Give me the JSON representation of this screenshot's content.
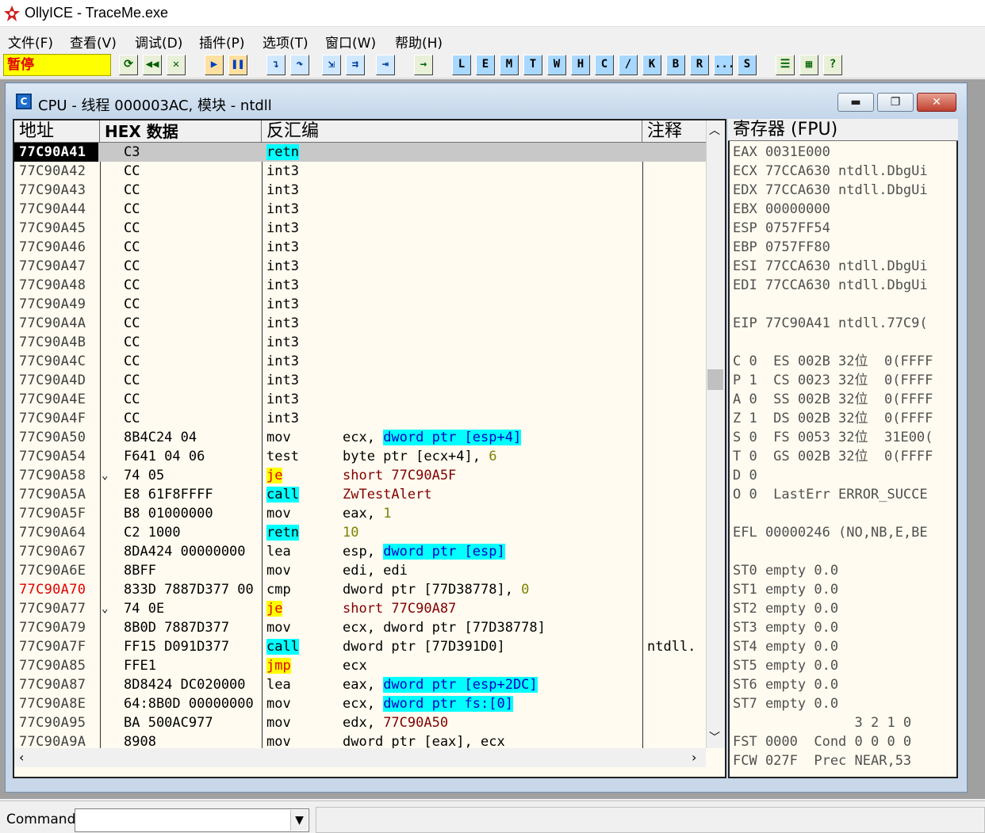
{
  "app": {
    "title": "OllyICE - TraceMe.exe"
  },
  "menu": [
    "文件(F)",
    "查看(V)",
    "调试(D)",
    "插件(P)",
    "选项(T)",
    "窗口(W)",
    "帮助(H)"
  ],
  "toolbar": {
    "status": "暂停",
    "letters": [
      "L",
      "E",
      "M",
      "T",
      "W",
      "H",
      "C",
      "/",
      "K",
      "B",
      "R",
      "...",
      "S"
    ]
  },
  "cpu_window": {
    "title": "CPU -  线程  000003AC, 模块 - ntdll",
    "headers": {
      "address": "地址",
      "hex": "HEX 数据",
      "disasm": "反汇编",
      "comment": "注释",
      "registers": "寄存器 (FPU)"
    }
  },
  "disasm_rows": [
    {
      "addr": "77C90A41",
      "hex": "C3",
      "mn": "retn",
      "op": "",
      "cm": ""
    },
    {
      "addr": "77C90A42",
      "hex": "CC",
      "mn": "int3",
      "op": "",
      "cm": ""
    },
    {
      "addr": "77C90A43",
      "hex": "CC",
      "mn": "int3",
      "op": "",
      "cm": ""
    },
    {
      "addr": "77C90A44",
      "hex": "CC",
      "mn": "int3",
      "op": "",
      "cm": ""
    },
    {
      "addr": "77C90A45",
      "hex": "CC",
      "mn": "int3",
      "op": "",
      "cm": ""
    },
    {
      "addr": "77C90A46",
      "hex": "CC",
      "mn": "int3",
      "op": "",
      "cm": ""
    },
    {
      "addr": "77C90A47",
      "hex": "CC",
      "mn": "int3",
      "op": "",
      "cm": ""
    },
    {
      "addr": "77C90A48",
      "hex": "CC",
      "mn": "int3",
      "op": "",
      "cm": ""
    },
    {
      "addr": "77C90A49",
      "hex": "CC",
      "mn": "int3",
      "op": "",
      "cm": ""
    },
    {
      "addr": "77C90A4A",
      "hex": "CC",
      "mn": "int3",
      "op": "",
      "cm": ""
    },
    {
      "addr": "77C90A4B",
      "hex": "CC",
      "mn": "int3",
      "op": "",
      "cm": ""
    },
    {
      "addr": "77C90A4C",
      "hex": "CC",
      "mn": "int3",
      "op": "",
      "cm": ""
    },
    {
      "addr": "77C90A4D",
      "hex": "CC",
      "mn": "int3",
      "op": "",
      "cm": ""
    },
    {
      "addr": "77C90A4E",
      "hex": "CC",
      "mn": "int3",
      "op": "",
      "cm": ""
    },
    {
      "addr": "77C90A4F",
      "hex": "CC",
      "mn": "int3",
      "op": "",
      "cm": ""
    },
    {
      "addr": "77C90A50",
      "hex": "8B4C24 04",
      "mn": "mov",
      "op": "ecx, ",
      "op2": "dword ptr [esp+4]",
      "cm": ""
    },
    {
      "addr": "77C90A54",
      "hex": "F641 04 06",
      "mn": "test",
      "op": "byte ptr [ecx+4], ",
      "num": "6",
      "cm": ""
    },
    {
      "addr": "77C90A58",
      "hex": "74 05",
      "mn": "je",
      "op": "short 77C90A5F",
      "cm": "",
      "arrow": "⌄"
    },
    {
      "addr": "77C90A5A",
      "hex": "E8 61F8FFFF",
      "mn": "call",
      "op": "ZwTestAlert",
      "cm": ""
    },
    {
      "addr": "77C90A5F",
      "hex": "B8 01000000",
      "mn": "mov",
      "op": "eax, ",
      "num": "1",
      "cm": ""
    },
    {
      "addr": "77C90A64",
      "hex": "C2 1000",
      "mn": "retn",
      "op": "",
      "num": "10",
      "cm": ""
    },
    {
      "addr": "77C90A67",
      "hex": "8DA424 00000000",
      "mn": "lea",
      "op": "esp, ",
      "op2": "dword ptr [esp]",
      "cm": ""
    },
    {
      "addr": "77C90A6E",
      "hex": "8BFF",
      "mn": "mov",
      "op": "edi, edi",
      "cm": ""
    },
    {
      "addr": "77C90A70",
      "hex": "833D 7887D377 00",
      "mn": "cmp",
      "op": "dword ptr [77D38778], ",
      "num": "0",
      "cm": ""
    },
    {
      "addr": "77C90A77",
      "hex": "74 0E",
      "mn": "je",
      "op": "short 77C90A87",
      "cm": "",
      "arrow": "⌄"
    },
    {
      "addr": "77C90A79",
      "hex": "8B0D 7887D377",
      "mn": "mov",
      "op": "ecx, dword ptr [77D38778]",
      "cm": ""
    },
    {
      "addr": "77C90A7F",
      "hex": "FF15 D091D377",
      "mn": "call",
      "op": "dword ptr [77D391D0]",
      "cm": "ntdll."
    },
    {
      "addr": "77C90A85",
      "hex": "FFE1",
      "mn": "jmp",
      "op": "ecx",
      "cm": ""
    },
    {
      "addr": "77C90A87",
      "hex": "8D8424 DC020000",
      "mn": "lea",
      "op": "eax, ",
      "op2": "dword ptr [esp+2DC]",
      "cm": ""
    },
    {
      "addr": "77C90A8E",
      "hex": "64:8B0D 00000000",
      "mn": "mov",
      "op": "ecx, ",
      "op2": "dword ptr fs:[0]",
      "cm": ""
    },
    {
      "addr": "77C90A95",
      "hex": "BA 500AC977",
      "mn": "mov",
      "op": "edx, ",
      "opred": "77C90A50",
      "cm": ""
    },
    {
      "addr": "77C90A9A",
      "hex": "8908",
      "mn": "mov",
      "op": "dword ptr [eax], ecx",
      "cm": ""
    }
  ],
  "registers": [
    "EAX 0031E000",
    "ECX 77CCA630 ntdll.DbgUi",
    "EDX 77CCA630 ntdll.DbgUi",
    "EBX 00000000",
    "ESP 0757FF54",
    "EBP 0757FF80",
    "ESI 77CCA630 ntdll.DbgUi",
    "EDI 77CCA630 ntdll.DbgUi",
    "",
    "EIP 77C90A41 ntdll.77C9(",
    "",
    "C 0  ES 002B 32位  0(FFFF",
    "P 1  CS 0023 32位  0(FFFF",
    "A 0  SS 002B 32位  0(FFFF",
    "Z 1  DS 002B 32位  0(FFFF",
    "S 0  FS 0053 32位  31E00(",
    "T 0  GS 002B 32位  0(FFFF",
    "D 0",
    "O 0  LastErr ERROR_SUCCE",
    "",
    "EFL 00000246 (NO,NB,E,BE",
    "",
    "ST0 empty 0.0",
    "ST1 empty 0.0",
    "ST2 empty 0.0",
    "ST3 empty 0.0",
    "ST4 empty 0.0",
    "ST5 empty 0.0",
    "ST6 empty 0.0",
    "ST7 empty 0.0",
    "               3 2 1 0",
    "FST 0000  Cond 0 0 0 0",
    "FCW 027F  Prec NEAR,53"
  ],
  "command": {
    "label": "Command"
  }
}
